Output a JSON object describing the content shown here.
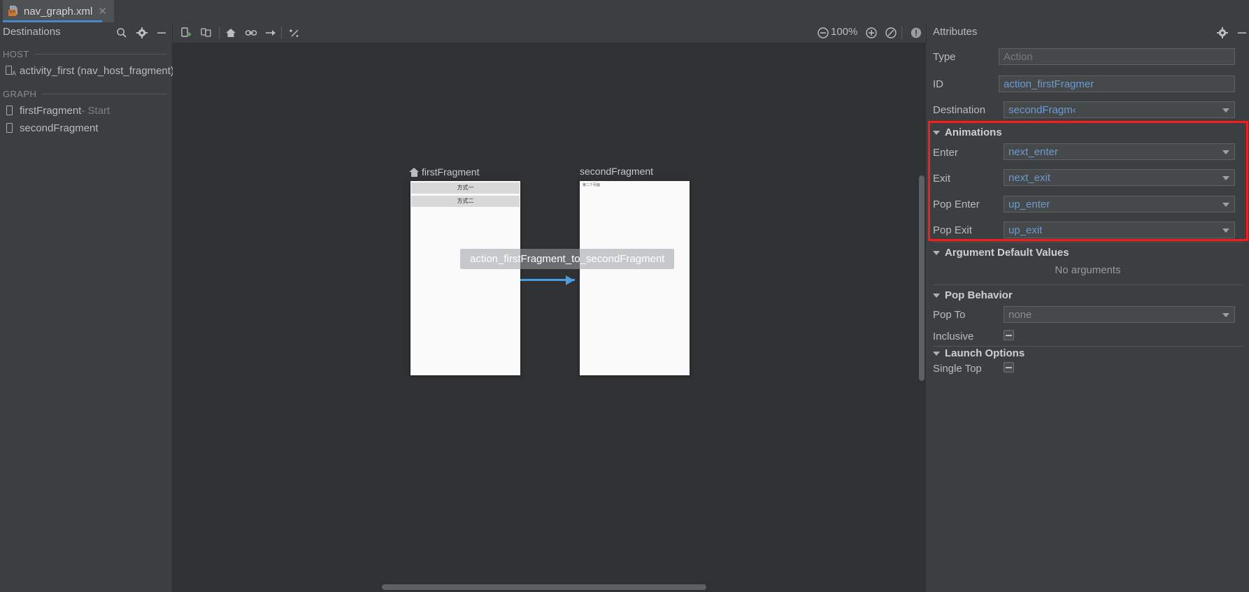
{
  "window": {
    "tab": {
      "label": "nav_graph.xml",
      "icon": "xml-file-icon",
      "close_icon": "close-icon"
    }
  },
  "toolbar": {
    "destinations_title": "Destinations",
    "search_icon": "search-icon",
    "gear_icon": "gear-icon",
    "minimize_icon": "minimize-icon",
    "new_destination_icon": "new-destination-icon",
    "nested_graph_icon": "nested-graph-icon",
    "start_destination_icon": "home-icon",
    "action_icon": "link-icon",
    "arrow_icon": "arrow-right-icon",
    "auto_arrange_icon": "magic-wand-icon",
    "zoom_out_icon": "zoom-out-icon",
    "zoom_level": "100%",
    "zoom_in_icon": "zoom-in-icon",
    "zoom_fit_icon": "zoom-to-fit-icon",
    "issues_icon": "warning-icon"
  },
  "destinations": {
    "groups": [
      {
        "title": "HOST",
        "items": [
          {
            "label": "activity_first (nav_host_fragment)",
            "icon": "activity-icon",
            "suffix": ""
          }
        ]
      },
      {
        "title": "GRAPH",
        "items": [
          {
            "label": "firstFragment",
            "icon": "fragment-icon",
            "suffix": " - Start"
          },
          {
            "label": "secondFragment",
            "icon": "fragment-icon",
            "suffix": ""
          }
        ]
      }
    ]
  },
  "canvas": {
    "fragments": [
      {
        "title": "firstFragment",
        "has_start_icon": true,
        "preview_buttons": [
          "方式一",
          "方式二"
        ],
        "preview_text": ""
      },
      {
        "title": "secondFragment",
        "has_start_icon": false,
        "preview_buttons": [],
        "preview_text": "第二个页面"
      }
    ],
    "action_label": "action_firstFragment_to_secondFragment",
    "arrow_color": "#4a9de0"
  },
  "attributes": {
    "panel_title": "Attributes",
    "gear_icon": "gear-icon",
    "minimize_icon": "minimize-icon",
    "fields": [
      {
        "label": "Type",
        "value": "Action",
        "kind": "text-readonly"
      },
      {
        "label": "ID",
        "value": "action_firstFragmer",
        "kind": "text"
      },
      {
        "label": "Destination",
        "value": "secondFragm‹",
        "kind": "dropdown"
      }
    ],
    "animations": {
      "title": "Animations",
      "highlight_color": "#ff1a1a",
      "rows": [
        {
          "label": "Enter",
          "value": "next_enter"
        },
        {
          "label": "Exit",
          "value": "next_exit"
        },
        {
          "label": "Pop Enter",
          "value": "up_enter"
        },
        {
          "label": "Pop Exit",
          "value": "up_exit"
        }
      ]
    },
    "arguments": {
      "title": "Argument Default Values",
      "empty_text": "No arguments"
    },
    "pop_behavior": {
      "title": "Pop Behavior",
      "pop_to_label": "Pop To",
      "pop_to_value": "none",
      "inclusive_label": "Inclusive"
    },
    "launch_options": {
      "title": "Launch Options",
      "single_top_label": "Single Top"
    }
  }
}
